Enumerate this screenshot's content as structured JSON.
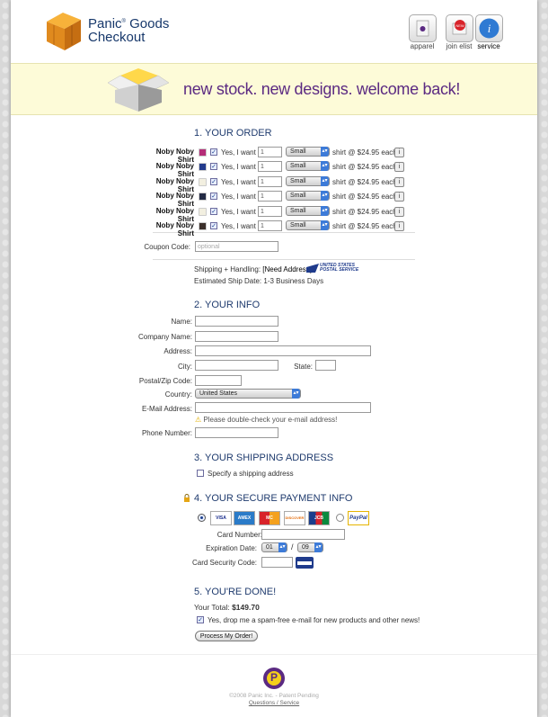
{
  "header": {
    "brand_line1": "Panic",
    "brand_reg": "®",
    "brand_line1b": " Goods",
    "brand_line2": "Checkout",
    "nav": [
      {
        "label": "apparel",
        "icon": "shirt-icon"
      },
      {
        "label": "join elist",
        "icon": "elist-icon"
      },
      {
        "label": "service",
        "icon": "info-icon"
      }
    ]
  },
  "banner": {
    "text": "new stock. new designs. welcome back!",
    "icon": "open-box-icon"
  },
  "order": {
    "heading": "1. YOUR ORDER",
    "yes_label": "Yes, I want",
    "price_label": "shirt @ $24.95 each",
    "info_glyph": "i",
    "items": [
      {
        "name": "Noby Noby Shirt",
        "color": "#b52d78",
        "qty": "1",
        "size": "Small"
      },
      {
        "name": "Noby Noby Shirt",
        "color": "#233b8c",
        "qty": "1",
        "size": "Small"
      },
      {
        "name": "Noby Noby Shirt",
        "color": "#f2efe0",
        "qty": "1",
        "size": "Small"
      },
      {
        "name": "Noby Noby Shirt",
        "color": "#222a44",
        "qty": "1",
        "size": "Small"
      },
      {
        "name": "Noby Noby Shirt",
        "color": "#f2efe0",
        "qty": "1",
        "size": "Small"
      },
      {
        "name": "Noby Noby Shirt",
        "color": "#3b2f2a",
        "qty": "1",
        "size": "Small"
      }
    ],
    "coupon_label": "Coupon Code:",
    "coupon_placeholder": "optional",
    "shipping_label": "Shipping + Handling:",
    "shipping_value": "[Need Address]",
    "usps_line1": "UNITED STATES",
    "usps_line2": "POSTAL SERVICE",
    "ship_date": "Estimated Ship Date: 1-3 Business Days"
  },
  "info": {
    "heading": "2. YOUR INFO",
    "name_label": "Name:",
    "company_label": "Company Name:",
    "address_label": "Address:",
    "city_label": "City:",
    "state_label": "State:",
    "zip_label": "Postal/Zip Code:",
    "country_label": "Country:",
    "country_value": "United States",
    "email_label": "E-Mail Address:",
    "email_warning": "Please double-check your e-mail address!",
    "phone_label": "Phone Number:"
  },
  "shipping": {
    "heading": "3. YOUR SHIPPING ADDRESS",
    "checkbox_label": "Specify a shipping address"
  },
  "payment": {
    "heading": "4. YOUR SECURE PAYMENT INFO",
    "cards": [
      "VISA",
      "AMEX",
      "MC",
      "DISCOVER",
      "JCB"
    ],
    "paypal": "PayPal",
    "card_number_label": "Card Number:",
    "expiration_label": "Expiration Date:",
    "exp_month": "01",
    "exp_year": "09",
    "exp_sep": "/",
    "security_label": "Card Security Code:"
  },
  "done": {
    "heading": "5. YOU'RE DONE!",
    "total_label": "Your Total:",
    "total_value": "$149.70",
    "newsletter_label": "Yes, drop me a spam-free e-mail for new products and other news!",
    "submit_label": "Process My Order!"
  },
  "footer": {
    "copyright": "©2008 Panic Inc. - Patent Pending",
    "link": "Questions / Service",
    "logo_letter": "P"
  }
}
